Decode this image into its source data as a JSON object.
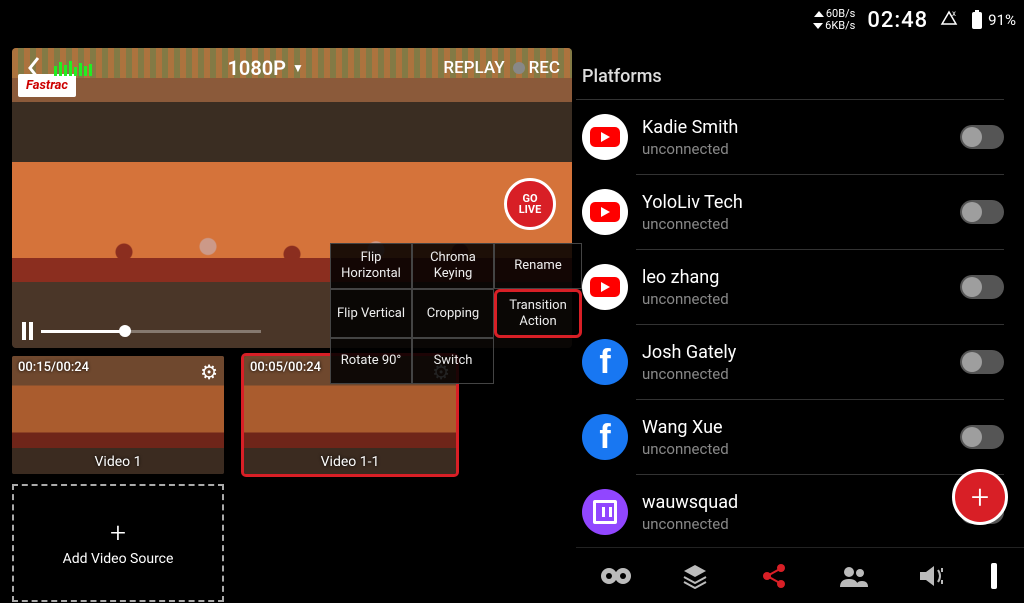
{
  "statusbar": {
    "net_up": "60B/s",
    "net_down": "6KB/s",
    "time": "02:48",
    "battery": "91%"
  },
  "preview": {
    "resolution": "1080P",
    "replay_label": "REPLAY",
    "rec_label": "REC",
    "golive_line1": "GO",
    "golive_line2": "LIVE",
    "sign_text": "Fastrac"
  },
  "context_menu": {
    "cells": [
      "Flip Horizontal",
      "Chroma Keying",
      "Rename",
      "Flip Vertical",
      "Cropping",
      "Transition Action",
      "Rotate 90°",
      "Switch",
      ""
    ]
  },
  "thumbs": [
    {
      "time": "00:15/00:24",
      "label": "Video 1",
      "active": false
    },
    {
      "time": "00:05/00:24",
      "label": "Video 1-1",
      "active": true
    }
  ],
  "add_source_label": "Add Video Source",
  "panel_title": "Platforms",
  "platforms": [
    {
      "icon": "youtube",
      "name": "Kadie Smith",
      "status": "unconnected"
    },
    {
      "icon": "youtube",
      "name": "YoloLiv Tech",
      "status": "unconnected"
    },
    {
      "icon": "youtube",
      "name": "leo zhang",
      "status": "unconnected"
    },
    {
      "icon": "facebook",
      "name": "Josh Gately",
      "status": "unconnected"
    },
    {
      "icon": "facebook",
      "name": "Wang Xue",
      "status": "unconnected"
    },
    {
      "icon": "twitch",
      "name": "wauwsquad",
      "status": "unconnected"
    }
  ],
  "nav_icons": [
    "controller-icon",
    "layers-icon",
    "share-icon",
    "people-icon",
    "volume-icon"
  ]
}
